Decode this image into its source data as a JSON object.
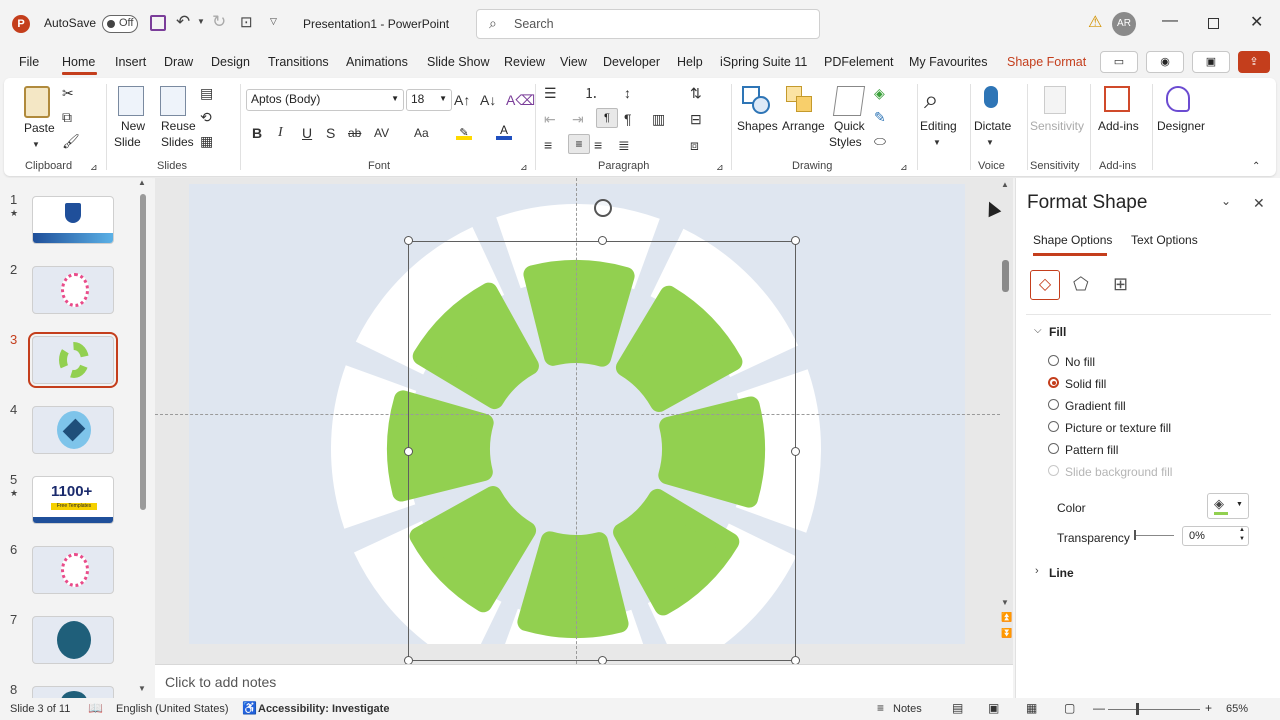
{
  "titlebar": {
    "autosave_label": "AutoSave",
    "autosave_state": "Off",
    "doc_title": "Presentation1  -  PowerPoint",
    "search_placeholder": "Search",
    "user_initials": "AR"
  },
  "menu": {
    "items": [
      "File",
      "Home",
      "Insert",
      "Draw",
      "Design",
      "Transitions",
      "Animations",
      "Slide Show",
      "Review",
      "View",
      "Developer",
      "Help",
      "iSpring Suite 11",
      "PDFelement",
      "My Favourites",
      "Shape Format"
    ],
    "active": "Home"
  },
  "ribbon": {
    "clipboard": {
      "paste": "Paste",
      "label": "Clipboard"
    },
    "slides": {
      "new_slide_1": "New",
      "new_slide_2": "Slide",
      "reuse_1": "Reuse",
      "reuse_2": "Slides",
      "label": "Slides"
    },
    "font": {
      "family": "Aptos (Body)",
      "size": "18",
      "label": "Font",
      "bold": "B",
      "italic": "I",
      "underline": "U",
      "shadow": "S",
      "strike": "ab",
      "spacing": "AV",
      "case": "Aa"
    },
    "paragraph": {
      "label": "Paragraph"
    },
    "drawing": {
      "shapes": "Shapes",
      "arrange": "Arrange",
      "quick_1": "Quick",
      "quick_2": "Styles",
      "label": "Drawing"
    },
    "editing": {
      "label": "Editing"
    },
    "voice": {
      "dictate": "Dictate",
      "label": "Voice"
    },
    "sensitivity": {
      "button": "Sensitivity",
      "label": "Sensitivity"
    },
    "addins": {
      "button": "Add-ins",
      "label": "Add-ins"
    },
    "designer": {
      "button": "Designer"
    }
  },
  "thumbnails": {
    "numbers": [
      "1",
      "2",
      "3",
      "4",
      "5",
      "6",
      "7",
      "8"
    ],
    "selected": "3",
    "slide5_text": "1100+",
    "slide5_sub": "Free Templates"
  },
  "notes": {
    "placeholder": "Click to add notes"
  },
  "pane": {
    "title": "Format Shape",
    "tabs": [
      "Shape Options",
      "Text Options"
    ],
    "fill_header": "Fill",
    "fill_options": [
      "No fill",
      "Solid fill",
      "Gradient fill",
      "Picture or texture fill",
      "Pattern fill",
      "Slide background fill"
    ],
    "selected_fill": "Solid fill",
    "color_label": "Color",
    "transparency_label": "Transparency",
    "transparency_value": "0%",
    "line_header": "Line"
  },
  "status": {
    "slide_info": "Slide 3 of 11",
    "language": "English (United States)",
    "accessibility": "Accessibility: Investigate",
    "notes": "Notes",
    "zoom": "65%"
  },
  "colors": {
    "accent": "#c43e1c",
    "shape_green": "#92d050",
    "slide_bg": "#dfe6f0"
  }
}
